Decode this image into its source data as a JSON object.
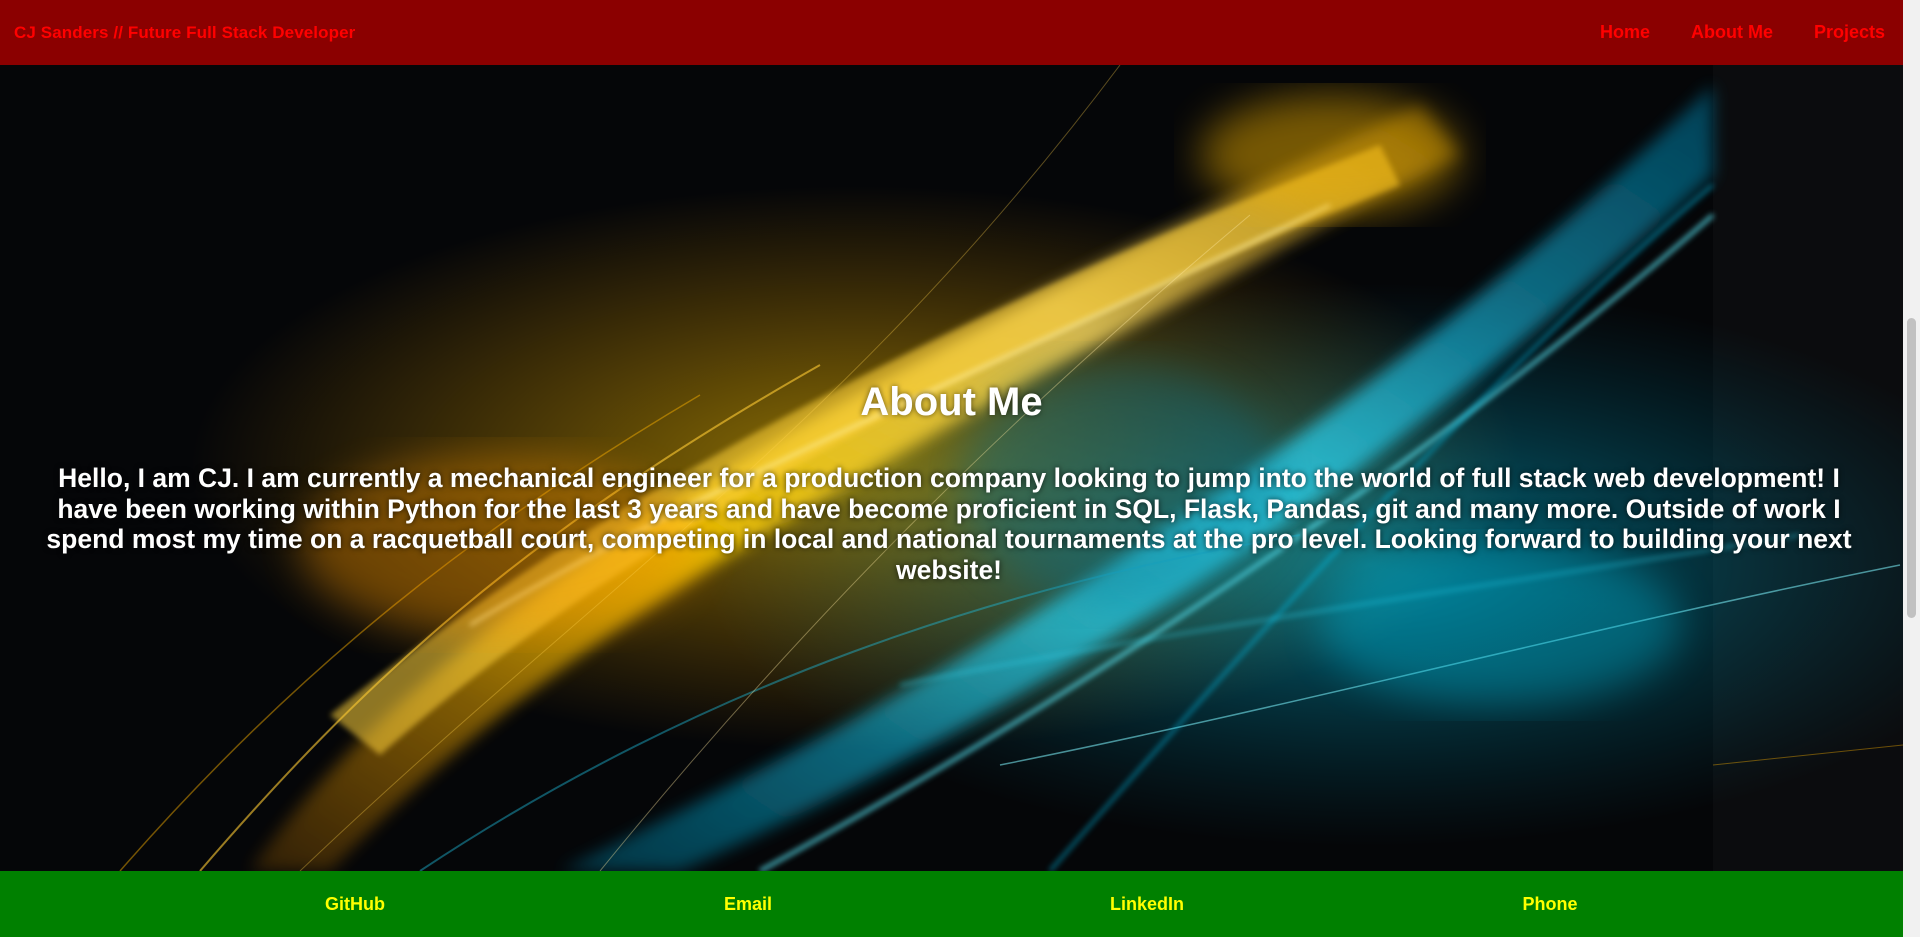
{
  "colors": {
    "header_bg": "#8b0000",
    "header_text": "#ff0000",
    "footer_bg": "#008000",
    "footer_text": "#ffff00",
    "body_text": "#ffffff"
  },
  "header": {
    "brand": "CJ Sanders // Future Full Stack Developer",
    "nav": [
      {
        "label": "Home"
      },
      {
        "label": "About Me"
      },
      {
        "label": "Projects"
      }
    ]
  },
  "about": {
    "title": "About Me",
    "text": "Hello, I am CJ. I am currently a mechanical engineer for a production company looking to jump into the world of full stack web development! I have been working within Python for the last 3 years and have become proficient in SQL, Flask, Pandas, git and many more. Outside of work I spend most my time on a racquetball court, competing in local and national tournaments at the pro level. Looking forward to building your next website!"
  },
  "footer": {
    "links": [
      {
        "label": "GitHub"
      },
      {
        "label": "Email"
      },
      {
        "label": "LinkedIn"
      },
      {
        "label": "Phone"
      }
    ]
  },
  "icons": {
    "background": "abstract-light-streaks-image"
  }
}
